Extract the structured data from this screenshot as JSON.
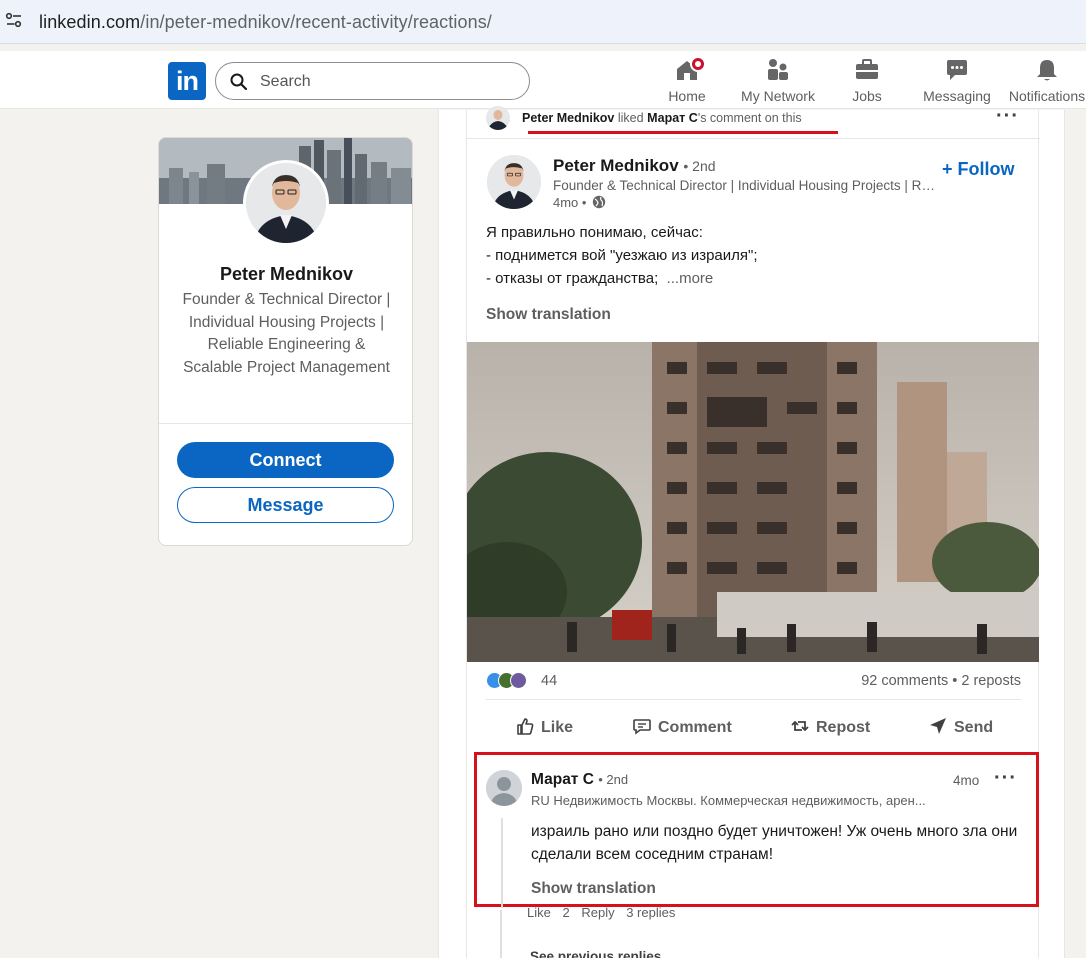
{
  "browser": {
    "url_host": "linkedin.com",
    "url_path": "/in/peter-mednikov/recent-activity/reactions/"
  },
  "nav": {
    "logo_text": "in",
    "search_placeholder": "Search",
    "items": [
      {
        "label": "Home",
        "icon": "home-icon"
      },
      {
        "label": "My Network",
        "icon": "people-icon"
      },
      {
        "label": "Jobs",
        "icon": "briefcase-icon"
      },
      {
        "label": "Messaging",
        "icon": "chat-icon"
      },
      {
        "label": "Notifications",
        "icon": "bell-icon"
      }
    ]
  },
  "profile_card": {
    "name": "Peter Mednikov",
    "headline": "Founder & Technical Director | Individual Housing Projects | Reliable Engineering & Scalable Project Management",
    "connect_label": "Connect",
    "message_label": "Message"
  },
  "activity": {
    "actor": "Peter Mednikov",
    "verb": "liked",
    "target": "Марат С",
    "suffix": "'s comment on this"
  },
  "post": {
    "author_name": "Peter Mednikov",
    "author_degree": "• 2nd",
    "author_headline": "Founder & Technical Director | Individual Housing Projects | Re...",
    "time": "4mo •",
    "follow_label": "+ Follow",
    "text_line1": "Я правильно понимаю, сейчас:",
    "text_line2": "- поднимется вой \"уезжаю из израиля\";",
    "text_line3": "- отказы от гражданства;",
    "more_label": "...more",
    "show_translation": "Show translation",
    "reaction_count": "44",
    "comments_reposts": "92 comments • 2 reposts",
    "actions": {
      "like": "Like",
      "comment": "Comment",
      "repost": "Repost",
      "send": "Send"
    }
  },
  "comment": {
    "author": "Марат С",
    "degree": "• 2nd",
    "time": "4mo",
    "headline": "RU Недвижимость Москвы. Коммерческая недвижимость, арен...",
    "text": "израиль рано или поздно будет уничтожен! Уж очень много зла они сделали всем соседним странам!",
    "show_translation": "Show translation",
    "like_label": "Like",
    "reaction_count": "2",
    "reply_label": "Reply",
    "replies": "3 replies",
    "see_previous": "See previous replies"
  },
  "colors": {
    "brand": "#0a66c2",
    "highlight": "#d8101c",
    "notification": "#cb112d"
  }
}
